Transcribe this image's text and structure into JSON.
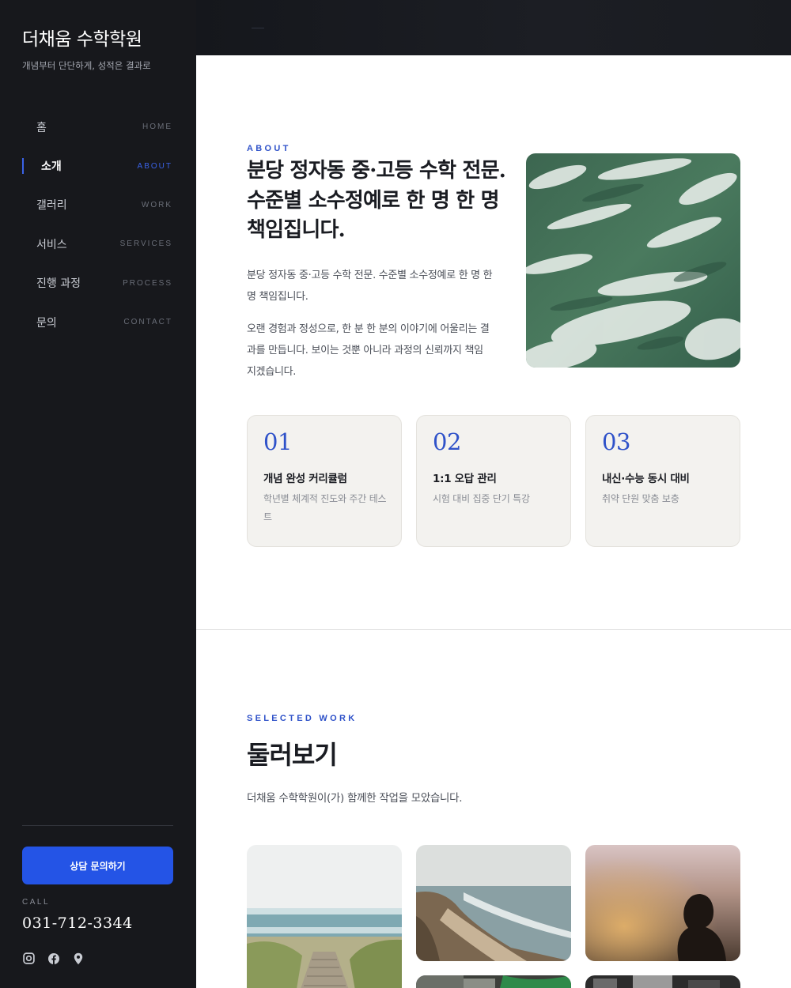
{
  "sidebar": {
    "brand_title": "더채움 수학학원",
    "brand_tagline": "개념부터 단단하게, 성적은 결과로",
    "nav": [
      {
        "ko": "홈",
        "en": "HOME",
        "active": false
      },
      {
        "ko": "소개",
        "en": "ABOUT",
        "active": true
      },
      {
        "ko": "갤러리",
        "en": "WORK",
        "active": false
      },
      {
        "ko": "서비스",
        "en": "SERVICES",
        "active": false
      },
      {
        "ko": "진행 과정",
        "en": "PROCESS",
        "active": false
      },
      {
        "ko": "문의",
        "en": "CONTACT",
        "active": false
      }
    ],
    "cta_label": "상담 문의하기",
    "call_label": "CALL",
    "phone": "031-712-3344",
    "socials": [
      "instagram-icon",
      "facebook-icon",
      "map-pin-icon"
    ]
  },
  "about": {
    "eyebrow": "ABOUT",
    "heading": "분당 정자동 중·고등 수학 전문. 수준별 소수정예로 한 명 한 명 책임집니다.",
    "paragraph1": "분당 정자동 중·고등 수학 전문. 수준별 소수정예로 한 명 한 명 책임집니다.",
    "paragraph2": "오랜 경험과 정성으로, 한 분 한 분의 이야기에 어울리는 결과를 만듭니다. 보이는 것뿐 아니라 과정의 신뢰까지 책임지겠습니다.",
    "features": [
      {
        "num": "01",
        "title": "개념 완성 커리큘럼",
        "desc": "학년별 체계적 진도와 주간 테스트"
      },
      {
        "num": "02",
        "title": "1:1 오답 관리",
        "desc": "시험 대비 집중 단기 특강"
      },
      {
        "num": "03",
        "title": "내신·수능 동시 대비",
        "desc": "취약 단원 맞춤 보충"
      }
    ]
  },
  "work": {
    "eyebrow": "SELECTED WORK",
    "heading": "둘러보기",
    "description": "더채움 수학학원이(가) 함께한 작업을 모았습니다."
  },
  "colors": {
    "sidebar_bg": "#17181c",
    "accent": "#2454e6",
    "accent_text": "#2f52c9",
    "feature_bg": "#f3f2ef"
  }
}
